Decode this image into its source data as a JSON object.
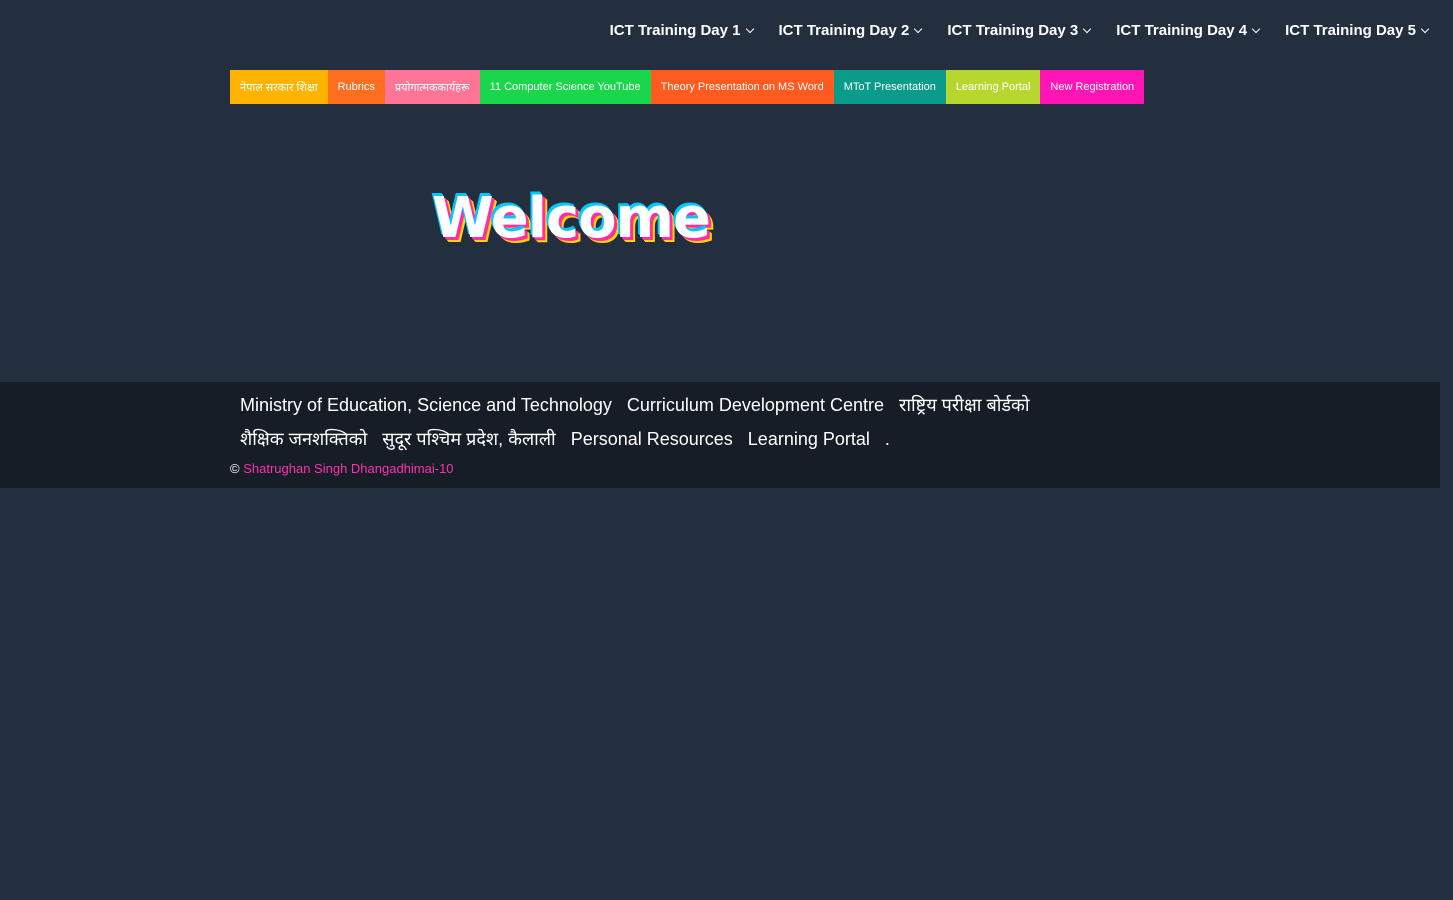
{
  "top_nav": {
    "items": [
      {
        "label": "ICT Training Day 1"
      },
      {
        "label": "ICT Training Day 2"
      },
      {
        "label": "ICT Training Day 3"
      },
      {
        "label": "ICT Training Day 4"
      },
      {
        "label": "ICT Training Day 5"
      }
    ]
  },
  "link_bar": {
    "items": [
      {
        "label": "नेपाल सरकार शिक्षा",
        "color": "#ffb300"
      },
      {
        "label": "Rubrics",
        "color": "#ff6d1f"
      },
      {
        "label": "प्रयोगात्मककार्यहरू",
        "color": "#ff7597"
      },
      {
        "label": "11 Computer Science YouTube",
        "color": "#19d64b"
      },
      {
        "label": "Theory Presentation on MS Word",
        "color": "#ff5a1f"
      },
      {
        "label": "MToT Presentation",
        "color": "#0b9b8a"
      },
      {
        "label": "Learning Portal",
        "color": "#b6d82e"
      },
      {
        "label": "New Registration",
        "color": "#ff15b4"
      }
    ]
  },
  "hero": {
    "welcome_text": "Welcome"
  },
  "footer": {
    "links": [
      {
        "label": "Ministry of Education, Science and Technology"
      },
      {
        "label": "Curriculum Development Centre"
      },
      {
        "label": "राष्ट्रिय परीक्षा बोर्डको"
      },
      {
        "label": "शैक्षिक जनशक्तिको"
      },
      {
        "label": "सुदूर पश्चिम प्रदेश, कैलाली"
      },
      {
        "label": "Personal Resources"
      },
      {
        "label": "Learning Portal"
      },
      {
        "label": "."
      }
    ],
    "copyright_symbol": "©",
    "author": "Shatrughan Singh Dhangadhimai-10"
  },
  "colors": {
    "background": "#232f3f",
    "footer_background": "#161d26",
    "author_link": "#ff2fb3"
  }
}
